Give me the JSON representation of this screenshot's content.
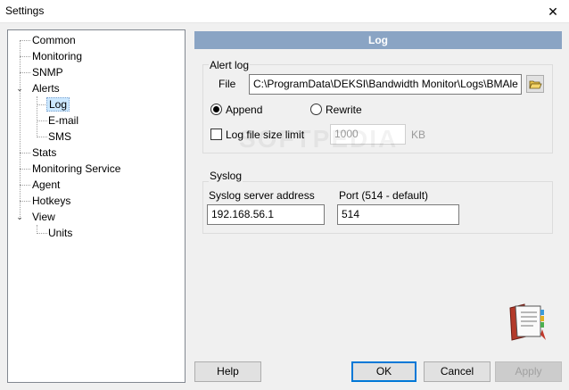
{
  "window": {
    "title": "Settings",
    "close_glyph": "✕"
  },
  "tree": {
    "items": [
      {
        "label": "Common"
      },
      {
        "label": "Monitoring"
      },
      {
        "label": "SNMP"
      },
      {
        "label": "Alerts"
      },
      {
        "label": "Log"
      },
      {
        "label": "E-mail"
      },
      {
        "label": "SMS"
      },
      {
        "label": "Stats"
      },
      {
        "label": "Monitoring Service"
      },
      {
        "label": "Agent"
      },
      {
        "label": "Hotkeys"
      },
      {
        "label": "View"
      },
      {
        "label": "Units"
      }
    ],
    "selected": "Log"
  },
  "panel": {
    "header": "Log"
  },
  "alert_log": {
    "title": "Alert log",
    "file_label": "File",
    "file_value": "C:\\ProgramData\\DEKSI\\Bandwidth Monitor\\Logs\\BMAle",
    "append_label": "Append",
    "rewrite_label": "Rewrite",
    "mode": "Append",
    "size_limit_label": "Log file size limit",
    "size_limit_checked": false,
    "size_value": "1000",
    "size_unit": "KB"
  },
  "syslog": {
    "title": "Syslog",
    "server_label": "Syslog server address",
    "server_value": "192.168.56.1",
    "port_label": "Port (514 - default)",
    "port_value": "514"
  },
  "buttons": {
    "help": "Help",
    "ok": "OK",
    "cancel": "Cancel",
    "apply": "Apply"
  },
  "icons": {
    "folder": "folder-open-icon",
    "logbook": "log-book-icon"
  },
  "watermark": "SOFTPEDIA"
}
